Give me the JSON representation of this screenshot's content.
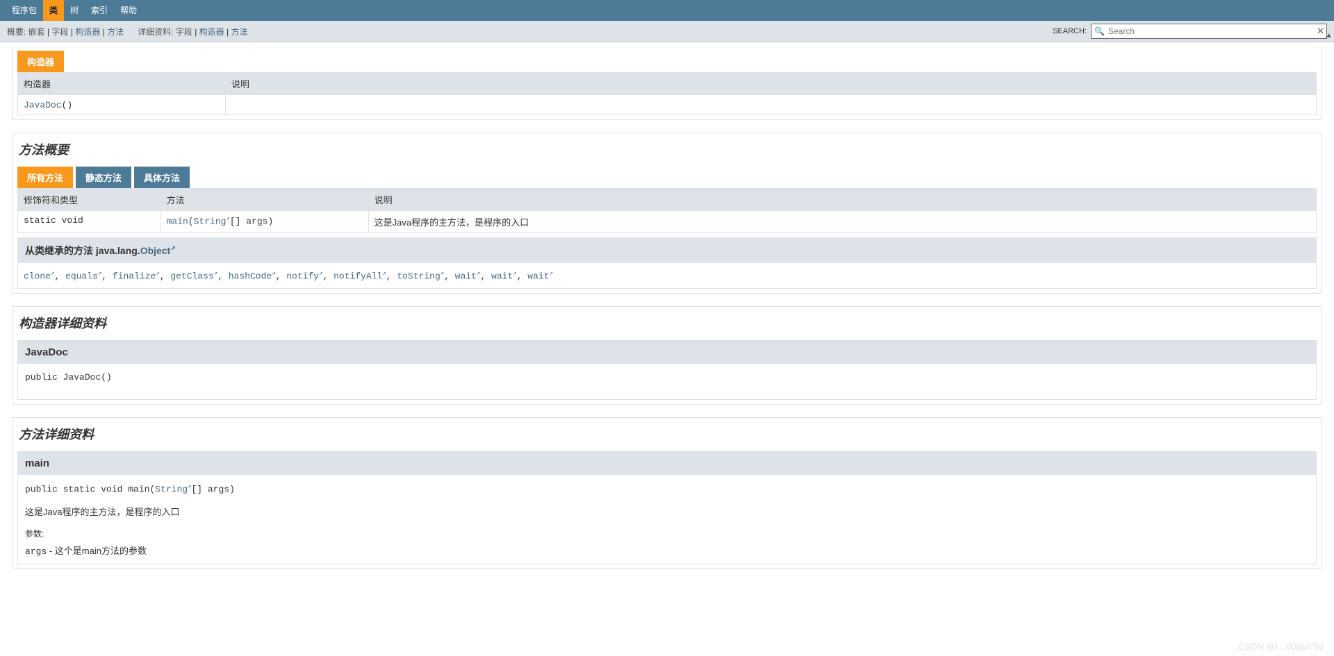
{
  "topnav": {
    "items": [
      "程序包",
      "类",
      "树",
      "索引",
      "帮助"
    ],
    "active": 1
  },
  "subnav": {
    "overview_label": "概要:",
    "overview_items": [
      "嵌套",
      "字段",
      "构造器",
      "方法"
    ],
    "detail_label": "详细资料:",
    "detail_items": [
      "字段",
      "构造器",
      "方法"
    ]
  },
  "search": {
    "label": "SEARCH:",
    "placeholder": "Search"
  },
  "constructor_summary": {
    "tab": "构造器",
    "headers": [
      "构造器",
      "说明"
    ],
    "rows": [
      {
        "name": "JavaDoc",
        "suffix": "()",
        "desc": ""
      }
    ]
  },
  "method_summary": {
    "title": "方法概要",
    "tabs": [
      "所有方法",
      "静态方法",
      "具体方法"
    ],
    "active": 0,
    "headers": [
      "修饰符和类型",
      "方法",
      "说明"
    ],
    "rows": [
      {
        "modifiers": "static void",
        "name": "main",
        "params_prefix": "(",
        "param_type": "String",
        "params_suffix": "[]  args)",
        "desc": "这是Java程序的主方法，是程序的入口"
      }
    ]
  },
  "inherited": {
    "heading_prefix": "从类继承的方法 java.lang.",
    "heading_link": "Object",
    "methods": [
      "clone",
      "equals",
      "finalize",
      "getClass",
      "hashCode",
      "notify",
      "notifyAll",
      "toString",
      "wait",
      "wait",
      "wait"
    ]
  },
  "constructor_detail": {
    "title": "构造器详细资料",
    "name": "JavaDoc",
    "signature_prefix": "public  ",
    "signature": "JavaDoc()"
  },
  "method_detail": {
    "title": "方法详细资料",
    "name": "main",
    "sig_prefix": "public static  void  main(",
    "sig_type": "String",
    "sig_suffix": "[]  args)",
    "desc": "这是Java程序的主方法，是程序的入口",
    "params_label": "参数:",
    "param_name": "args",
    "param_desc": " - 这个是main方法的参数"
  },
  "watermark": "CSDN @l…000μℓ791"
}
